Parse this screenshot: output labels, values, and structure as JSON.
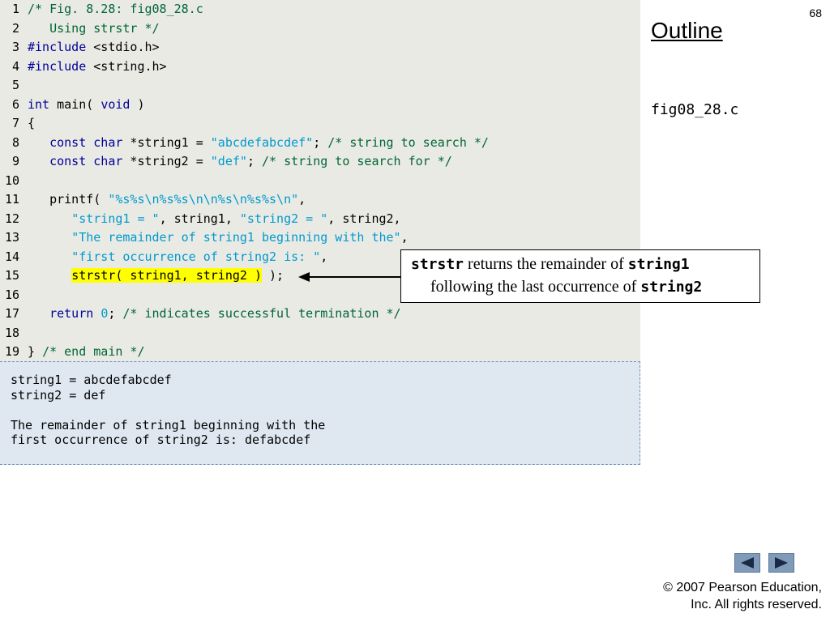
{
  "page_number": "68",
  "outline_title": "Outline",
  "file_name": "fig08_28.c",
  "code_lines": [
    {
      "num": "1",
      "parts": [
        {
          "t": "/* Fig. 8.28: fig08_28.c",
          "c": "comment"
        }
      ]
    },
    {
      "num": "2",
      "parts": [
        {
          "t": "   Using strstr */",
          "c": "comment"
        }
      ]
    },
    {
      "num": "3",
      "parts": [
        {
          "t": "#include",
          "c": "kw"
        },
        {
          "t": " <stdio.h>",
          "c": ""
        }
      ]
    },
    {
      "num": "4",
      "parts": [
        {
          "t": "#include",
          "c": "kw"
        },
        {
          "t": " <string.h>",
          "c": ""
        }
      ]
    },
    {
      "num": "5",
      "parts": []
    },
    {
      "num": "6",
      "parts": [
        {
          "t": "int",
          "c": "kw"
        },
        {
          "t": " main( ",
          "c": ""
        },
        {
          "t": "void",
          "c": "kw"
        },
        {
          "t": " )",
          "c": ""
        }
      ]
    },
    {
      "num": "7",
      "parts": [
        {
          "t": "{",
          "c": ""
        }
      ]
    },
    {
      "num": "8",
      "parts": [
        {
          "t": "   ",
          "c": ""
        },
        {
          "t": "const char",
          "c": "kw"
        },
        {
          "t": " *string1 = ",
          "c": ""
        },
        {
          "t": "\"abcdefabcdef\"",
          "c": "str"
        },
        {
          "t": "; ",
          "c": ""
        },
        {
          "t": "/* string to search */",
          "c": "comment"
        }
      ]
    },
    {
      "num": "9",
      "parts": [
        {
          "t": "   ",
          "c": ""
        },
        {
          "t": "const char",
          "c": "kw"
        },
        {
          "t": " *string2 = ",
          "c": ""
        },
        {
          "t": "\"def\"",
          "c": "str"
        },
        {
          "t": "; ",
          "c": ""
        },
        {
          "t": "/* string to search for */",
          "c": "comment"
        }
      ]
    },
    {
      "num": "10",
      "parts": []
    },
    {
      "num": "11",
      "parts": [
        {
          "t": "   printf( ",
          "c": ""
        },
        {
          "t": "\"%s%s\\n%s%s\\n\\n%s\\n%s%s\\n\"",
          "c": "str"
        },
        {
          "t": ",",
          "c": ""
        }
      ]
    },
    {
      "num": "12",
      "parts": [
        {
          "t": "      ",
          "c": ""
        },
        {
          "t": "\"string1 = \"",
          "c": "str"
        },
        {
          "t": ", string1, ",
          "c": ""
        },
        {
          "t": "\"string2 = \"",
          "c": "str"
        },
        {
          "t": ", string2,",
          "c": ""
        }
      ]
    },
    {
      "num": "13",
      "parts": [
        {
          "t": "      ",
          "c": ""
        },
        {
          "t": "\"The remainder of string1 beginning with the\"",
          "c": "str"
        },
        {
          "t": ",",
          "c": ""
        }
      ]
    },
    {
      "num": "14",
      "parts": [
        {
          "t": "      ",
          "c": ""
        },
        {
          "t": "\"first occurrence of string2 is: \"",
          "c": "str"
        },
        {
          "t": ",",
          "c": ""
        }
      ]
    },
    {
      "num": "15",
      "parts": [
        {
          "t": "      ",
          "c": ""
        },
        {
          "t": "strstr( string1, string2 )",
          "c": "hl"
        },
        {
          "t": " );",
          "c": ""
        }
      ]
    },
    {
      "num": "16",
      "parts": []
    },
    {
      "num": "17",
      "parts": [
        {
          "t": "   ",
          "c": ""
        },
        {
          "t": "return",
          "c": "kw"
        },
        {
          "t": " ",
          "c": ""
        },
        {
          "t": "0",
          "c": "num"
        },
        {
          "t": "; ",
          "c": ""
        },
        {
          "t": "/* indicates successful termination */",
          "c": "comment"
        }
      ]
    },
    {
      "num": "18",
      "parts": []
    },
    {
      "num": "19",
      "parts": [
        {
          "t": "} ",
          "c": ""
        },
        {
          "t": "/* end main */",
          "c": "comment"
        }
      ]
    }
  ],
  "output_lines": [
    "string1 = abcdefabcdef",
    "string2 = def",
    "",
    "The remainder of string1 beginning with the",
    "first occurrence of string2 is: defabcdef"
  ],
  "callout": {
    "line1_code": "strstr",
    "line1_text": " returns the remainder of ",
    "line1_code2": "string1",
    "line2_text": "following the last occurrence of ",
    "line2_code": "string2"
  },
  "copyright": {
    "line1": "© 2007 Pearson Education,",
    "line2": "Inc.  All rights reserved."
  },
  "colors": {
    "comment": "#006633",
    "keyword": "#000099",
    "string": "#0099cc",
    "highlight": "#ffff00",
    "code_bg": "#eaeae5",
    "output_bg": "#dfe8f1",
    "nav_button": "#7f9bb9"
  },
  "nav": {
    "prev_icon": "triangle-left-icon",
    "next_icon": "triangle-right-icon"
  }
}
